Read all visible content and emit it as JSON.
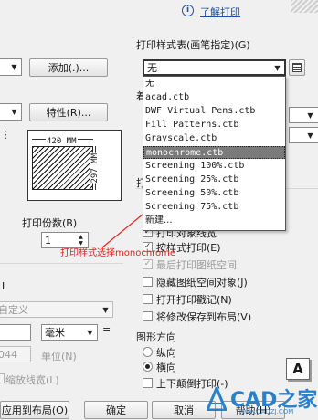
{
  "header": {
    "help_link": "了解打印",
    "info_icon": "info-circle-icon"
  },
  "left": {
    "add_button": "添加(.)...",
    "properties_button": "特性(R)...",
    "paper_width": "420 MM",
    "paper_height": "297 MM",
    "copies_label": "打印份数(B)",
    "copies_value": "1",
    "custom_partial": "自定义",
    "units_value": "毫米",
    "units_equals": "=",
    "scale_value": "044",
    "units_label": "单位(N)",
    "scale_lineweights": "缩放线宽(L)",
    "apply_button": "应用到布局(O)",
    "ok_button": "确定",
    "cancel_button": "取消",
    "help_button": "帮助(H)",
    "section_char": "I"
  },
  "right": {
    "plot_style_label": "打印样式表(画笔指定)(G)",
    "plot_style_value": "无",
    "partial_label_1": "着",
    "partial_label_2": "打",
    "options": [
      {
        "label": "打印对象线宽",
        "checked": true,
        "disabled": false
      },
      {
        "label": "按样式打印(E)",
        "checked": true,
        "disabled": false
      },
      {
        "label": "最后打印图纸空间",
        "checked": true,
        "disabled": true
      },
      {
        "label": "隐藏图纸空间对象(J)",
        "checked": false,
        "disabled": false
      },
      {
        "label": "打开打印戳记(N)",
        "checked": false,
        "disabled": false
      },
      {
        "label": "将修改保存到布局(V)",
        "checked": false,
        "disabled": false
      }
    ],
    "orientation_label": "图形方向",
    "portrait": "纵向",
    "landscape": "横向",
    "upside_down": "上下颠倒打印(-)",
    "orientation_icon": "A"
  },
  "dropdown": {
    "items": [
      "无",
      "acad.ctb",
      "DWF Virtual Pens.ctb",
      "Fill Patterns.ctb",
      "Grayscale.ctb",
      "monochrome.ctb",
      "Screening 100%.ctb",
      "Screening 25%.ctb",
      "Screening 50%.ctb",
      "Screening 75%.ctb",
      "新建..."
    ],
    "selected_index": 5
  },
  "annotation": {
    "text": "打印样式选择monochrome",
    "color": "#e8201a"
  },
  "watermark": {
    "logo_text": "CAD之家",
    "url": "www.CADZJ.COM",
    "color": "#2a80c9"
  }
}
